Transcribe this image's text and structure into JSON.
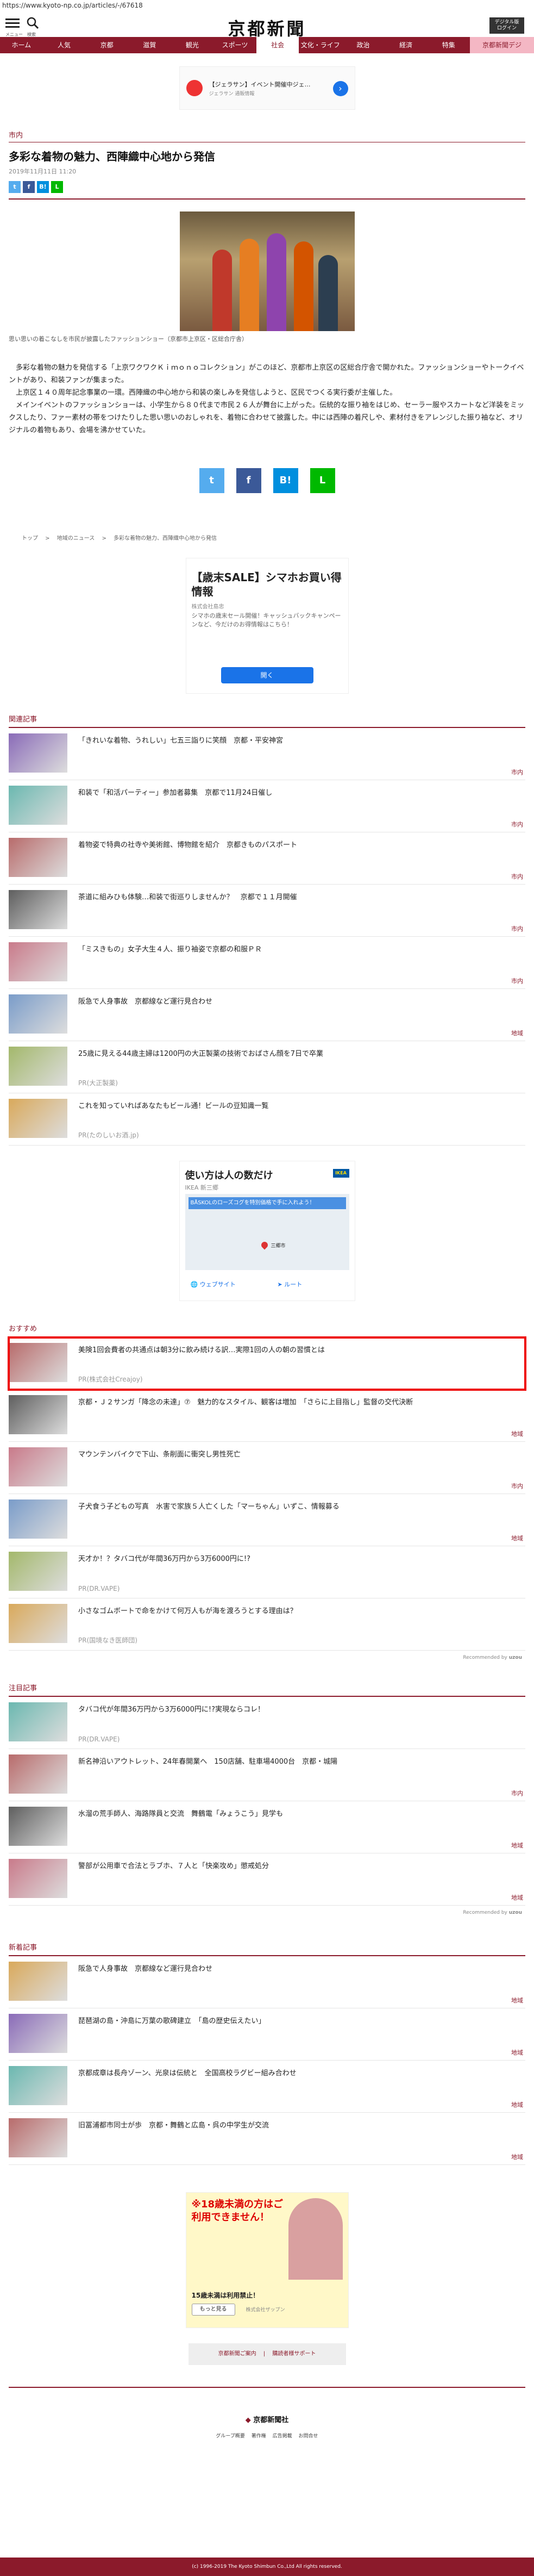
{
  "url": "https://www.kyoto-np.co.jp/articles/-/67618",
  "header": {
    "menu_label": "メニュー",
    "search_label": "検索",
    "logo": "京都新聞",
    "digital_button": "デジタル版\nログイン"
  },
  "nav": [
    "ホーム",
    "人気",
    "京都",
    "滋賀",
    "観光",
    "スポーツ",
    "社会",
    "文化・ライフ",
    "政治",
    "経済",
    "特集",
    "京都新聞デジ"
  ],
  "nav_active": 6,
  "top_ad": {
    "title": "【ジェラサン】イベント開催中ジェ…",
    "sub": "ジェラサン 通販情報"
  },
  "article": {
    "category": "市内",
    "title": "多彩な着物の魅力、西陣織中心地から発信",
    "date": "2019年11月11日 11:20",
    "caption": "思い思いの着こなしを市民が披露したファッションショー（京都市上京区・区総合庁舎）",
    "paragraphs": [
      "　多彩な着物の魅力を発信する「上京ワクワクＫｉｍｏｎｏコレクション」がこのほど、京都市上京区の区総合庁舎で開かれた。ファッションショーやトークイベントがあり、和装ファンが集まった。",
      "　上京区１４０周年記念事業の一環。西陣織の中心地から和装の楽しみを発信しようと、区民でつくる実行委が主催した。",
      "　メインイベントのファッションショーは、小学生から８０代まで市民２６人が舞台に上がった。伝統的な振り袖をはじめ、セーラー服やスカートなど洋装をミックスしたり、ファー素材の帯をつけたりした思い思いのおしゃれを、着物に合わせて披露した。中には西陣の着尺しや、素材付きをアレンジした振り袖など、オリジナルの着物もあり、会場を沸かせていた。"
    ]
  },
  "breadcrumb": [
    "トップ",
    "地域のニュース",
    "多彩な着物の魅力、西陣織中心地から発信"
  ],
  "mid_ad": {
    "title": "【歳末SALE】シマホお買い得情報",
    "advertiser": "株式会社島忠",
    "body": "シマホの歳末セール開催！キャッシュバックキャンペーンなど、今だけのお得情報はこちら！",
    "button": "開く"
  },
  "related": {
    "heading": "関連記事",
    "items": [
      {
        "title": "「きれいな着物、うれしい」七五三詣りに笑顔　京都・平安神宮",
        "tag": "市内"
      },
      {
        "title": "和装で「和活パーティー」参加者募集　京都で11月24日催し",
        "tag": "市内"
      },
      {
        "title": "着物姿で特典の社寺や美術館、博物館を紹介　京都きものパスポート",
        "tag": "市内"
      },
      {
        "title": "茶道に組みひも体験…和装で街巡りしませんか？　京都で１１月開催",
        "tag": "市内"
      },
      {
        "title": "「ミスきもの」女子大生４人、振り袖姿で京都の和服ＰＲ",
        "tag": "市内"
      },
      {
        "title": "阪急で人身事故　京都線など運行見合わせ",
        "tag": "地域"
      },
      {
        "title": "25歳に見える44歳主婦は1200円の大正製薬の技術でおばさん顔を7日で卒業",
        "pr": "PR(大正製薬)"
      },
      {
        "title": "これを知っていればあなたもビール通！ビールの豆知識一覧",
        "pr": "PR(たのしいお酒.jp)"
      }
    ]
  },
  "map_ad": {
    "title": "使い方は人の数だけ",
    "sub": "IKEA 新三郷",
    "promo": "BÅSKOLのローズコグを特別価格で手に入れよう！",
    "place": "三郷市",
    "link_web": "ウェブサイト",
    "link_route": "ルート"
  },
  "recommend": {
    "heading": "おすすめ",
    "items": [
      {
        "title": "美険1回会費者の共通点は朝3分に飲み続ける訳…実際1回の人の朝の習慣とは",
        "pr": "PR(株式会社Creajoy)"
      },
      {
        "title": "京都・Ｊ２サンガ「降念の未達」⑦　魅力的なスタイル、観客は増加　「さらに上目指し」監督の交代決断",
        "tag": "地域"
      },
      {
        "title": "マウンテンバイクで下山、条削面に衝突し男性死亡",
        "tag": "市内"
      },
      {
        "title": "子犬食う子どもの写真　水害で家族５人亡くした「マーちゃん」いずこ、情報募る",
        "tag": "地域"
      },
      {
        "title": "天才か！？タバコ代が年間36万円から3万6000円に!?",
        "pr": "PR(DR.VAPE)"
      },
      {
        "title": "小さなゴムボートで命をかけて何万人もが海を渡ろうとする理由は？",
        "pr": "PR(国境なき医師団)"
      }
    ],
    "powered": "Recommended by"
  },
  "featured": {
    "heading": "注目記事",
    "items": [
      {
        "title": "タバコ代が年間36万円から3万6000円に!?実現ならコレ！",
        "pr": "PR(DR.VAPE)"
      },
      {
        "title": "新名神沿いアウトレット、24年春開業へ　150店舗、駐車場4000台　京都・城陽",
        "tag": "市内"
      },
      {
        "title": "水溜の荒手師人、海路隊員と交流　舞鶴電「みょうこう」見学も",
        "tag": "地域"
      },
      {
        "title": "警部が公用車で合法とラブホ、７人と「快楽攻め」懲戒処分",
        "tag": "地域"
      }
    ],
    "powered": "Recommended by"
  },
  "latest": {
    "heading": "新着記事",
    "items": [
      {
        "title": "阪急で人身事故　京都線など運行見合わせ",
        "tag": "地域"
      },
      {
        "title": "琵琶湖の島・沖島に万葉の歌碑建立　「島の歴史伝えたい」",
        "tag": "地域"
      },
      {
        "title": "京都成章は長舟ゾーン、光泉は伝統と　全国高校ラグビー組み合わせ",
        "tag": "地域"
      },
      {
        "title": "旧冨浦都市同士が歩　京都・舞鶴と広島・呉の中学生が交流",
        "tag": "地域"
      }
    ]
  },
  "bottom_ad": {
    "headline": "※18歳未満の方はご利用できません！",
    "sub": "15歳未満は利用禁止！",
    "button": "もっと見る",
    "advertiser": "株式会社ザップン"
  },
  "footer": {
    "links": [
      "京都新聞ご案内",
      "購読者様サポート"
    ],
    "logo": "京都新聞社",
    "sub_links": [
      "グループ概要",
      "著作権",
      "広告掲載",
      "お問合せ"
    ],
    "copyright": "(c) 1996-2019 The Kyoto Shimbun Co.,Ltd All rights reserved."
  },
  "colors": {
    "brand": "#8b1a2b",
    "twitter": "#55acee",
    "facebook": "#3b5998",
    "hatena": "#008fde",
    "line": "#00b900"
  }
}
